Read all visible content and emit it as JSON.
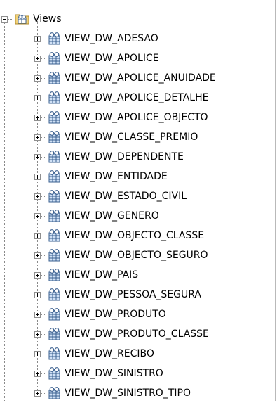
{
  "tree": {
    "root": {
      "label": "Views",
      "icon": "folder-views-icon",
      "expanded": true
    },
    "items": [
      {
        "label": "VIEW_DW_ADESAO"
      },
      {
        "label": "VIEW_DW_APOLICE"
      },
      {
        "label": "VIEW_DW_APOLICE_ANUIDADE"
      },
      {
        "label": "VIEW_DW_APOLICE_DETALHE"
      },
      {
        "label": "VIEW_DW_APOLICE_OBJECTO"
      },
      {
        "label": "VIEW_DW_CLASSE_PREMIO"
      },
      {
        "label": "VIEW_DW_DEPENDENTE"
      },
      {
        "label": "VIEW_DW_ENTIDADE"
      },
      {
        "label": "VIEW_DW_ESTADO_CIVIL"
      },
      {
        "label": "VIEW_DW_GENERO"
      },
      {
        "label": "VIEW_DW_OBJECTO_CLASSE"
      },
      {
        "label": "VIEW_DW_OBJECTO_SEGURO"
      },
      {
        "label": "VIEW_DW_PAIS"
      },
      {
        "label": "VIEW_DW_PESSOA_SEGURA"
      },
      {
        "label": "VIEW_DW_PRODUTO"
      },
      {
        "label": "VIEW_DW_PRODUTO_CLASSE"
      },
      {
        "label": "VIEW_DW_RECIBO"
      },
      {
        "label": "VIEW_DW_SINISTRO"
      },
      {
        "label": "VIEW_DW_SINISTRO_TIPO"
      }
    ],
    "item_icon": "view-table-icon",
    "colors": {
      "icon_border": "#3a5f8f",
      "icon_fill": "#cfe0f5",
      "folder": "#f2d27a"
    }
  }
}
